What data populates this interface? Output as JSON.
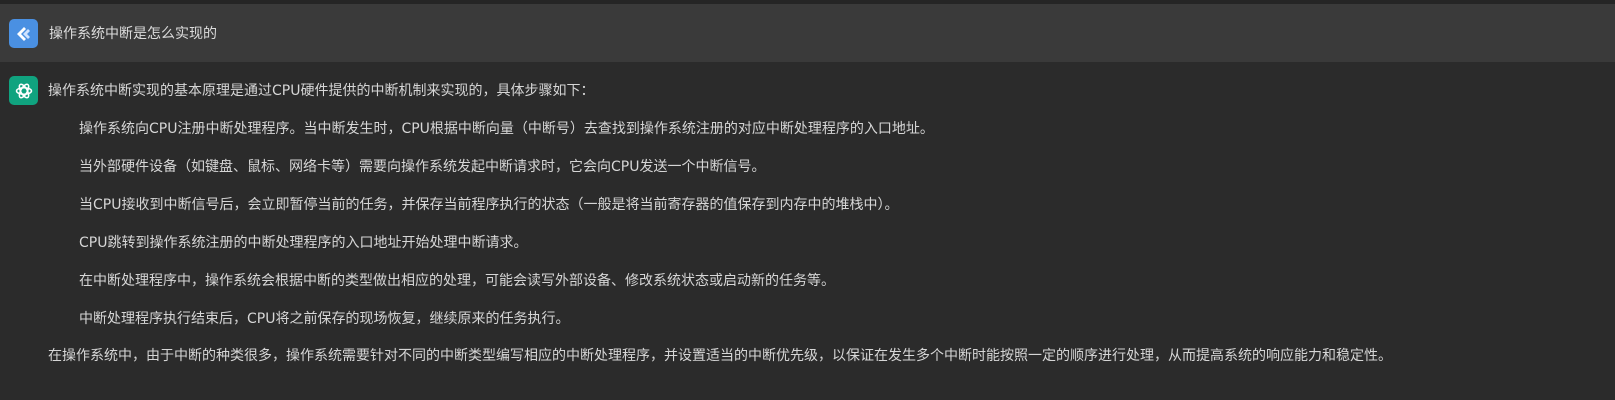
{
  "user_message": {
    "avatar_icon": "app-logo-icon",
    "text": "操作系统中断是怎么实现的"
  },
  "assistant_message": {
    "avatar_icon": "openai-logo-icon",
    "intro": "操作系统中断实现的基本原理是通过CPU硬件提供的中断机制来实现的，具体步骤如下：",
    "steps": [
      "操作系统向CPU注册中断处理程序。当中断发生时，CPU根据中断向量（中断号）去查找到操作系统注册的对应中断处理程序的入口地址。",
      "当外部硬件设备（如键盘、鼠标、网络卡等）需要向操作系统发起中断请求时，它会向CPU发送一个中断信号。",
      "当CPU接收到中断信号后，会立即暂停当前的任务，并保存当前程序执行的状态（一般是将当前寄存器的值保存到内存中的堆栈中）。",
      "CPU跳转到操作系统注册的中断处理程序的入口地址开始处理中断请求。",
      "在中断处理程序中，操作系统会根据中断的类型做出相应的处理，可能会读写外部设备、修改系统状态或启动新的任务等。",
      "中断处理程序执行结束后，CPU将之前保存的现场恢复，继续原来的任务执行。"
    ],
    "conclusion": "在操作系统中，由于中断的种类很多，操作系统需要针对不同的中断类型编写相应的中断处理程序，并设置适当的中断优先级，以保证在发生多个中断时能按照一定的顺序进行处理，从而提高系统的响应能力和稳定性。"
  },
  "colors": {
    "background": "#2b2b2b",
    "user_row_background": "#3a3a3a",
    "user_avatar": "#4a90e2",
    "assistant_avatar": "#10a37f",
    "text": "#d6d6d6"
  }
}
